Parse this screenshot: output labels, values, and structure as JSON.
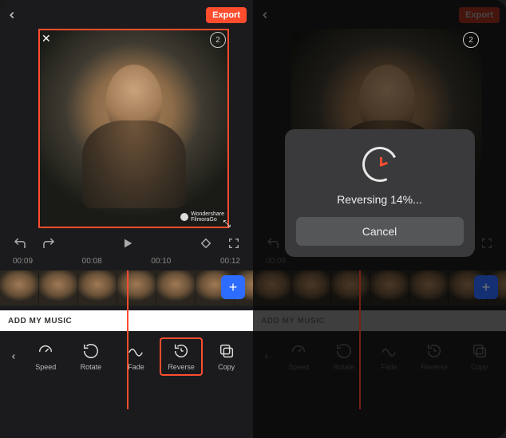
{
  "header": {
    "export_label": "Export",
    "undo_badge": "2"
  },
  "preview": {
    "watermark_line1": "Wondershare",
    "watermark_line2": "FilmoraGo"
  },
  "timeline": {
    "marks": [
      "00:09",
      "00:08",
      "00:10",
      "00:12"
    ],
    "marks_right": [
      "00:09"
    ]
  },
  "music": {
    "add_label": "ADD MY MUSIC"
  },
  "tools": {
    "items": [
      {
        "label": "Speed"
      },
      {
        "label": "Rotate"
      },
      {
        "label": "Fade"
      },
      {
        "label": "Reverse"
      },
      {
        "label": "Copy"
      }
    ],
    "selected_index": 3
  },
  "modal": {
    "message": "Reversing 14%...",
    "cancel_label": "Cancel"
  }
}
